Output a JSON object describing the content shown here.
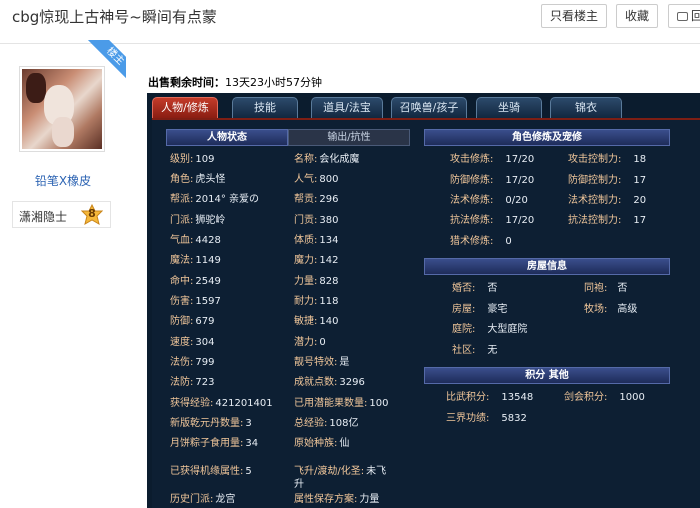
{
  "header": {
    "title": "cbg惊现上古神号~瞬间有点蒙",
    "only_owner_label": "只看楼主",
    "favorite_label": "收藏",
    "reply_label": "回"
  },
  "user": {
    "owner_badge": "楼主",
    "name": "铅笔X橡皮",
    "level_name": "潇湘隐士",
    "level_num": "8"
  },
  "game": {
    "sale_label": "出售剩余时间：",
    "sale_value": "13天23小时57分钟",
    "tabs": [
      "人物/修炼",
      "技能",
      "道具/法宝",
      "召唤兽/孩子",
      "坐骑",
      "锦衣"
    ],
    "status_tab": "人物状态",
    "io_tab": "输出/抗性",
    "left_rows": [
      {
        "k": "级别:",
        "v": "109"
      },
      {
        "k": "角色:",
        "v": "虎头怪"
      },
      {
        "k": "帮派:",
        "v": "2014° 亲爱の"
      },
      {
        "k": "门派:",
        "v": "狮驼岭"
      },
      {
        "k": "气血:",
        "v": "4428"
      },
      {
        "k": "魔法:",
        "v": "1149"
      },
      {
        "k": "命中:",
        "v": "2549"
      },
      {
        "k": "伤害:",
        "v": "1597"
      },
      {
        "k": "防御:",
        "v": "679"
      },
      {
        "k": "速度:",
        "v": "304"
      },
      {
        "k": "法伤:",
        "v": "799"
      },
      {
        "k": "法防:",
        "v": "723"
      },
      {
        "k": "获得经验:",
        "v": "421201401"
      },
      {
        "k": "新版乾元丹数量:",
        "v": "3"
      },
      {
        "k": "月饼粽子食用量:",
        "v": "34"
      },
      {
        "k": "已获得机缘属性:",
        "v": "5"
      },
      {
        "k": "历史门派:",
        "v": "龙宫"
      }
    ],
    "mid_rows": [
      {
        "k": "名称:",
        "v": "会化成魔"
      },
      {
        "k": "人气:",
        "v": "800"
      },
      {
        "k": "帮贡:",
        "v": "296"
      },
      {
        "k": "门贡:",
        "v": "380"
      },
      {
        "k": "体质:",
        "v": "134"
      },
      {
        "k": "魔力:",
        "v": "142"
      },
      {
        "k": "力量:",
        "v": "828"
      },
      {
        "k": "耐力:",
        "v": "118"
      },
      {
        "k": "敏捷:",
        "v": "140"
      },
      {
        "k": "潜力:",
        "v": "0"
      },
      {
        "k": "靓号特效:",
        "v": "是"
      },
      {
        "k": "成就点数:",
        "v": "3296"
      },
      {
        "k": "已用潜能果数量:",
        "v": "100"
      },
      {
        "k": "总经验:",
        "v": "108亿"
      },
      {
        "k": "原始种族:",
        "v": "仙"
      },
      {
        "k": "飞升/渡劫/化圣:",
        "v": "未飞"
      },
      {
        "k": "属性保存方案:",
        "v": "力量"
      }
    ],
    "mid_wrap": "升",
    "cultivation_title": "角色修炼及宠修",
    "cultivation": [
      {
        "k1": "攻击修炼:",
        "v1": "17/20",
        "k2": "攻击控制力:",
        "v2": "18"
      },
      {
        "k1": "防御修炼:",
        "v1": "17/20",
        "k2": "防御控制力:",
        "v2": "17"
      },
      {
        "k1": "法术修炼:",
        "v1": "0/20",
        "k2": "法术控制力:",
        "v2": "20"
      },
      {
        "k1": "抗法修炼:",
        "v1": "17/20",
        "k2": "抗法控制力:",
        "v2": "17"
      },
      {
        "k1": "猎术修炼:",
        "v1": "0",
        "k2": "",
        "v2": ""
      }
    ],
    "house_title": "房屋信息",
    "house": [
      {
        "k1": "婚否:",
        "v1": "否",
        "k2": "同袍:",
        "v2": "否"
      },
      {
        "k1": "房屋:",
        "v1": "豪宅",
        "k2": "牧场:",
        "v2": "高级"
      },
      {
        "k1": "庭院:",
        "v1": "大型庭院",
        "k2": "",
        "v2": ""
      },
      {
        "k1": "社区:",
        "v1": "无",
        "k2": "",
        "v2": ""
      }
    ],
    "score_title": "积分 其他",
    "score": [
      {
        "k1": "比武积分:",
        "v1": "13548",
        "k2": "剑会积分:",
        "v2": "1000"
      },
      {
        "k1": "三界功绩:",
        "v1": "5832",
        "k2": "",
        "v2": ""
      }
    ]
  }
}
